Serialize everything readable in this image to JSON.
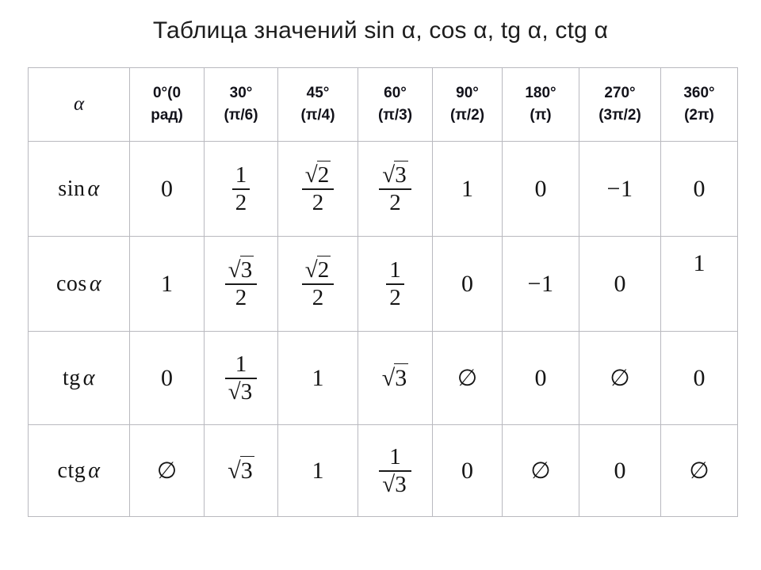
{
  "title": "Таблица значений sin α, cos α, tg α, ctg α",
  "table": {
    "corner_label": "α",
    "columns": [
      {
        "deg": "0°(0",
        "rad": "рад)"
      },
      {
        "deg": "30°",
        "rad": "(π/6)"
      },
      {
        "deg": "45°",
        "rad": "(π/4)"
      },
      {
        "deg": "60°",
        "rad": "(π/3)"
      },
      {
        "deg": "90°",
        "rad": "(π/2)"
      },
      {
        "deg": "180°",
        "rad": "(π)"
      },
      {
        "deg": "270°",
        "rad": "(3π/2)"
      },
      {
        "deg": "360°",
        "rad": "(2π)"
      }
    ],
    "rows": [
      {
        "fn": "sin",
        "arg": "α",
        "cells": [
          "0",
          "1/2",
          "√2/2",
          "√3/2",
          "1",
          "0",
          "−1",
          "0"
        ]
      },
      {
        "fn": "cos",
        "arg": "α",
        "cells": [
          "1",
          "√3/2",
          "√2/2",
          "1/2",
          "0",
          "−1",
          "0",
          "1"
        ]
      },
      {
        "fn": "tg",
        "arg": "α",
        "cells": [
          "0",
          "1/√3",
          "1",
          "√3",
          "∅",
          "0",
          "∅",
          "0"
        ]
      },
      {
        "fn": "ctg",
        "arg": "α",
        "cells": [
          "∅",
          "√3",
          "1",
          "1/√3",
          "0",
          "∅",
          "0",
          "∅"
        ]
      }
    ],
    "parts": {
      "one": "1",
      "two": "2",
      "three": "3",
      "zero": "0",
      "minus_one": "−1",
      "empty_set": "∅",
      "radical": "√"
    }
  },
  "colors": {
    "header_bg": "#eceef8",
    "border": "#b9b9bf",
    "text": "#141414",
    "page_bg": "#ffffff"
  }
}
